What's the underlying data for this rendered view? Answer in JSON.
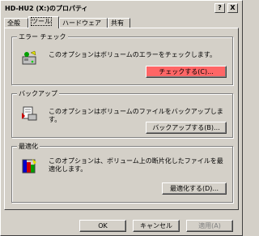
{
  "window": {
    "title": "HD-HU2 (X:)のプロパティ",
    "help_label": "?",
    "close_label": "X"
  },
  "tabs": [
    {
      "label": "全般"
    },
    {
      "label": "ツール"
    },
    {
      "label": "ハードウェア"
    },
    {
      "label": "共有"
    }
  ],
  "error_check": {
    "title": "エラー チェック",
    "description": "このオプションはボリュームのエラーをチェックします。",
    "button": "チェックする(C)..."
  },
  "backup": {
    "title": "バックアップ",
    "description": "このオプションはボリュームのファイルをバックアップします。",
    "button": "バックアップする(B)..."
  },
  "defrag": {
    "title": "最適化",
    "description": "このオプションは、ボリューム上の断片化したファイルを最適化します。",
    "button": "最適化する(D)..."
  },
  "footer": {
    "ok": "OK",
    "cancel": "キャンセル",
    "apply": "適用(A)"
  },
  "colors": {
    "face": "#d4d0c8",
    "highlight_button": "#ff6666"
  }
}
